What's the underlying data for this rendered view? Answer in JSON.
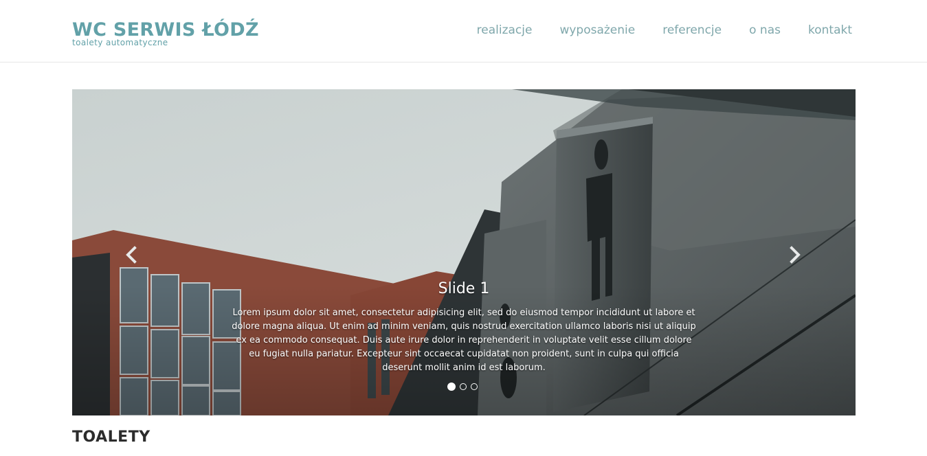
{
  "brand": {
    "title": "WC SERWIS ŁÓDŹ",
    "subtitle": "toalety automatyczne",
    "color": "#62a1a8"
  },
  "nav": {
    "items": [
      {
        "label": "realizacje"
      },
      {
        "label": "wyposażenie"
      },
      {
        "label": "referencje"
      },
      {
        "label": "o nas"
      },
      {
        "label": "kontakt"
      }
    ]
  },
  "carousel": {
    "slide": {
      "title": "Slide 1",
      "text": "Lorem ipsum dolor sit amet, consectetur adipisicing elit, sed do eiusmod tempor incididunt ut labore et dolore magna aliqua. Ut enim ad minim veniam, quis nostrud exercitation ullamco laboris nisi ut aliquip ex ea commodo consequat. Duis aute irure dolor in reprehenderit in voluptate velit esse cillum dolore eu fugiat nulla pariatur. Excepteur sint occaecat cupidatat non proident, sunt in culpa qui officia deserunt mollit anim id est laborum."
    },
    "indicator_count": 3,
    "active_index": 0,
    "prev_icon": "chevron-left-icon",
    "next_icon": "chevron-right-icon"
  },
  "section": {
    "title": "TOALETY"
  }
}
